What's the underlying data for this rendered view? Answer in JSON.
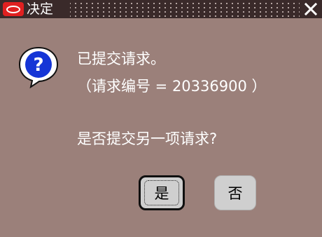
{
  "window": {
    "title": "决定",
    "close_glyph": "✕"
  },
  "dialog": {
    "icon": "help-question-icon",
    "message_line1": "已提交请求。",
    "message_line2": "（请求编号 = 20336900 ）",
    "question": "是否提交另一项请求?"
  },
  "buttons": {
    "yes_label": "是",
    "no_label": "否"
  },
  "colors": {
    "background": "#9b807a",
    "titlebar": "#3a2a2a",
    "logo_red": "#e02020",
    "text": "#ffffff",
    "button_face": "#cfcfcf"
  }
}
